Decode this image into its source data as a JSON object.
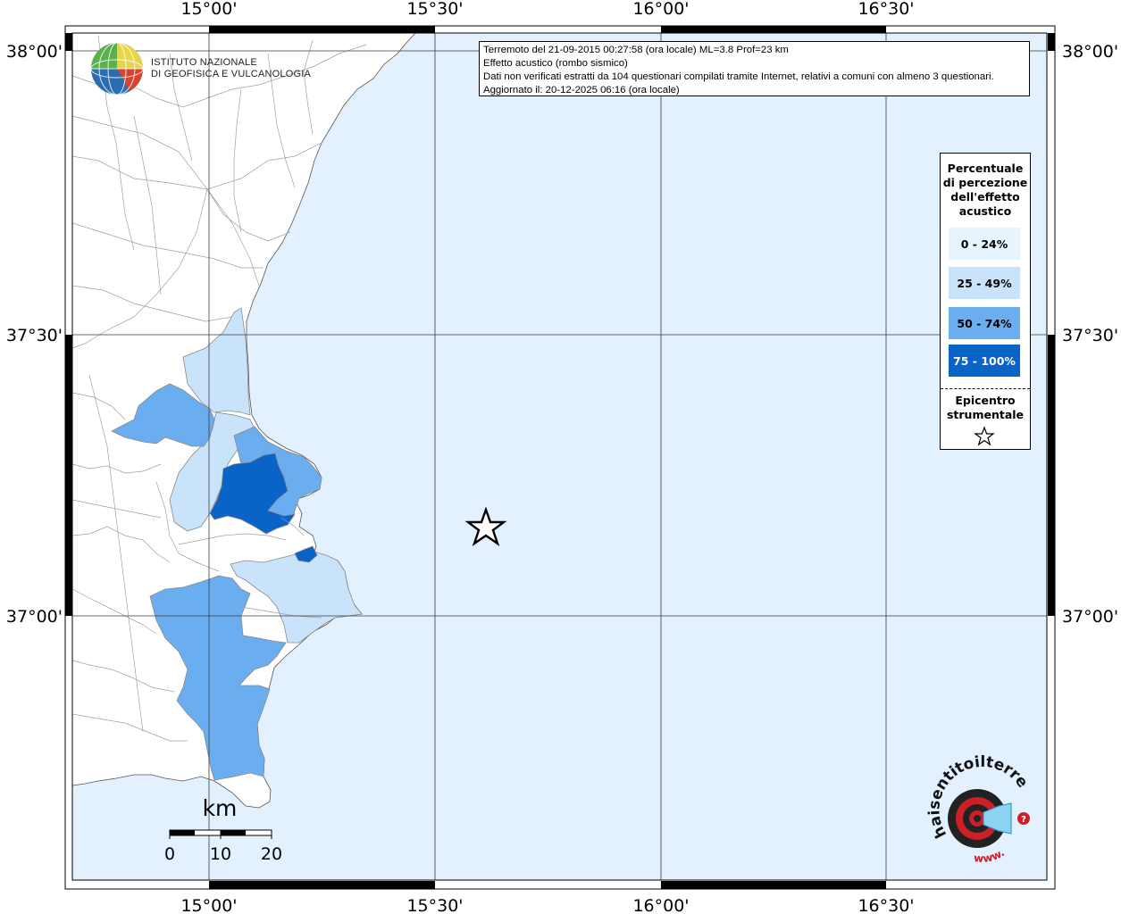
{
  "info": {
    "line1": "Terremoto del 21-09-2015 00:27:58 (ora locale) ML=3.8 Prof=23 km",
    "line2": "Effetto acustico (rombo sismico)",
    "line3": "Dati non verificati estratti da 104 questionari compilati tramite Internet, relativi a comuni con almeno 3 questionari.",
    "line4": "Aggiornato il: 20-12-2025 06:16 (ora locale)"
  },
  "axes": {
    "top": [
      "15°00'",
      "15°30'",
      "16°00'",
      "16°30'"
    ],
    "bottom": [
      "15°00'",
      "15°30'",
      "16°00'",
      "16°30'"
    ],
    "left": [
      "38°00'",
      "37°30'",
      "37°00'"
    ],
    "right": [
      "38°00'",
      "37°30'",
      "37°00'"
    ]
  },
  "legend": {
    "title_lines": [
      "Percentuale",
      "di percezione",
      "dell'effetto",
      "acustico"
    ],
    "classes": [
      {
        "label": "0 - 24%",
        "color": "#e6f4ff",
        "text_color": "#000000"
      },
      {
        "label": "25 - 49%",
        "color": "#c9e3fa",
        "text_color": "#000000"
      },
      {
        "label": "50 - 74%",
        "color": "#6aaef0",
        "text_color": "#000000"
      },
      {
        "label": "75 - 100%",
        "color": "#0a64c8",
        "text_color": "#ffffff"
      }
    ],
    "epicenter_lines": [
      "Epicentro",
      "strumentale"
    ]
  },
  "logo": {
    "ingv_line1": "ISTITUTO NAZIONALE",
    "ingv_line2": "DI GEOFISICA E VULCANOLOGIA",
    "hsit": "haisentitoilterremoto.it",
    "hsit_url": "www."
  },
  "scale": {
    "unit": "km",
    "ticks": [
      "0",
      "10",
      "20"
    ]
  },
  "colors": {
    "sea": "#e2f1fd",
    "land": "#ffffff",
    "border": "#8a8a8a"
  }
}
